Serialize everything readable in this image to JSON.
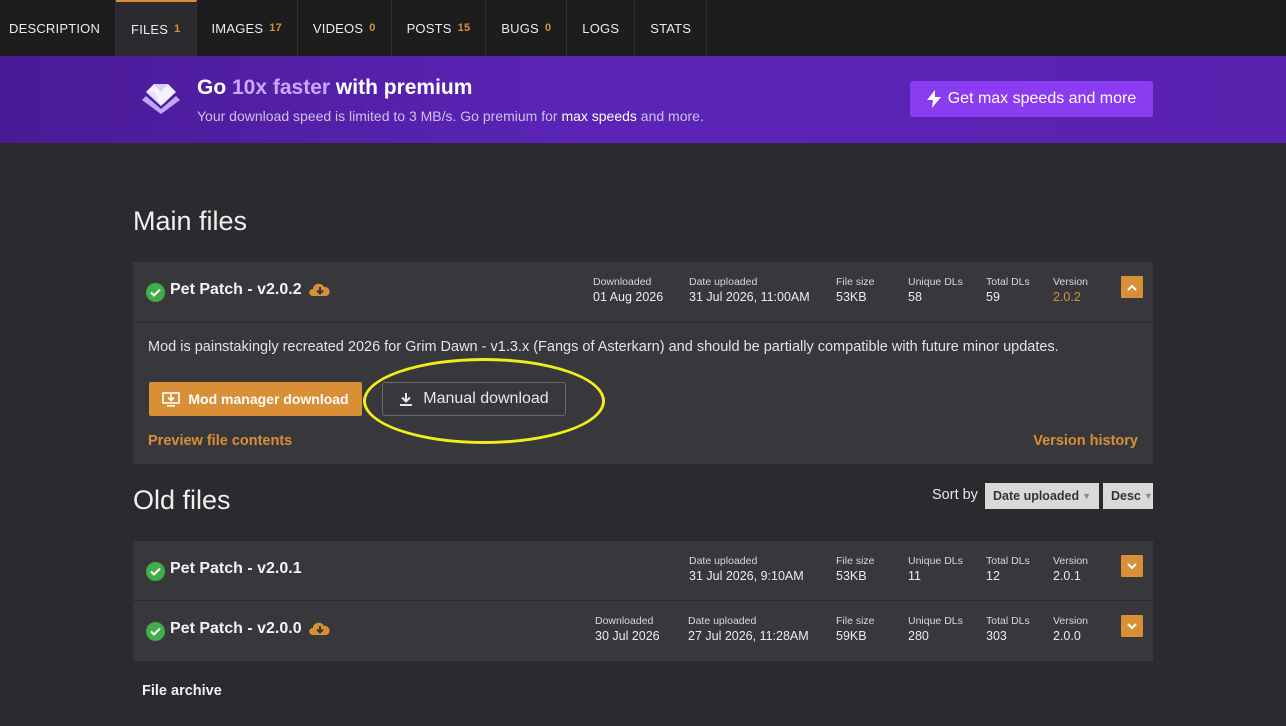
{
  "tabs": [
    {
      "label": "DESCRIPTION",
      "count": ""
    },
    {
      "label": "FILES",
      "count": "1"
    },
    {
      "label": "IMAGES",
      "count": "17"
    },
    {
      "label": "VIDEOS",
      "count": "0"
    },
    {
      "label": "POSTS",
      "count": "15"
    },
    {
      "label": "BUGS",
      "count": "0"
    },
    {
      "label": "LOGS",
      "count": ""
    },
    {
      "label": "STATS",
      "count": ""
    }
  ],
  "banner": {
    "title_pre": "Go ",
    "title_hl": "10x faster",
    "title_post": " with premium",
    "sub_pre": "Your download speed is limited to 3 MB/s. Go premium for ",
    "sub_bold": "max speeds",
    "sub_post": " and more.",
    "button": "Get max speeds and more"
  },
  "main": {
    "heading": "Main files",
    "file": {
      "name": "Pet Patch - v2.0.2",
      "downloaded_label": "Downloaded",
      "downloaded": "01 Aug 2026",
      "uploaded_label": "Date uploaded",
      "uploaded": "31 Jul 2026, 11:00AM",
      "size_label": "File size",
      "size": "53KB",
      "unique_label": "Unique DLs",
      "unique": "58",
      "total_label": "Total DLs",
      "total": "59",
      "version_label": "Version",
      "version": "2.0.2",
      "description": "Mod is painstakingly recreated 2026 for Grim Dawn - v1.3.x (Fangs of Asterkarn) and should be partially compatible with future minor updates.",
      "mod_manager_btn": "Mod manager download",
      "manual_btn": "Manual download",
      "preview_link": "Preview file contents",
      "history_link": "Version history"
    }
  },
  "old": {
    "heading": "Old files",
    "sort_label": "Sort by",
    "sort_field": "Date uploaded",
    "sort_order": "Desc",
    "files": [
      {
        "name": "Pet Patch - v2.0.1",
        "downloaded_label": "",
        "downloaded": "",
        "uploaded_label": "Date uploaded",
        "uploaded": "31 Jul 2026, 9:10AM",
        "size_label": "File size",
        "size": "53KB",
        "unique_label": "Unique DLs",
        "unique": "11",
        "total_label": "Total DLs",
        "total": "12",
        "version_label": "Version",
        "version": "2.0.1"
      },
      {
        "name": "Pet Patch - v2.0.0",
        "downloaded_label": "Downloaded",
        "downloaded": "30 Jul 2026",
        "uploaded_label": "Date uploaded",
        "uploaded": "27 Jul 2026, 11:28AM",
        "size_label": "File size",
        "size": "59KB",
        "unique_label": "Unique DLs",
        "unique": "280",
        "total_label": "Total DLs",
        "total": "303",
        "version_label": "Version",
        "version": "2.0.0"
      }
    ]
  },
  "archive": "File archive",
  "icons": {
    "banner": "diamond-icon",
    "premium": "lightning-icon",
    "verified": "check-circle-icon",
    "downloaded": "cloud-download-icon",
    "mod_manager": "monitor-download-icon",
    "manual": "download-arrow-icon",
    "expand": "chevron-icon"
  },
  "colors": {
    "accent": "#d98f35",
    "premium": "#8a3cf0",
    "success": "#3fae49",
    "highlight": "#f3ec1b"
  }
}
